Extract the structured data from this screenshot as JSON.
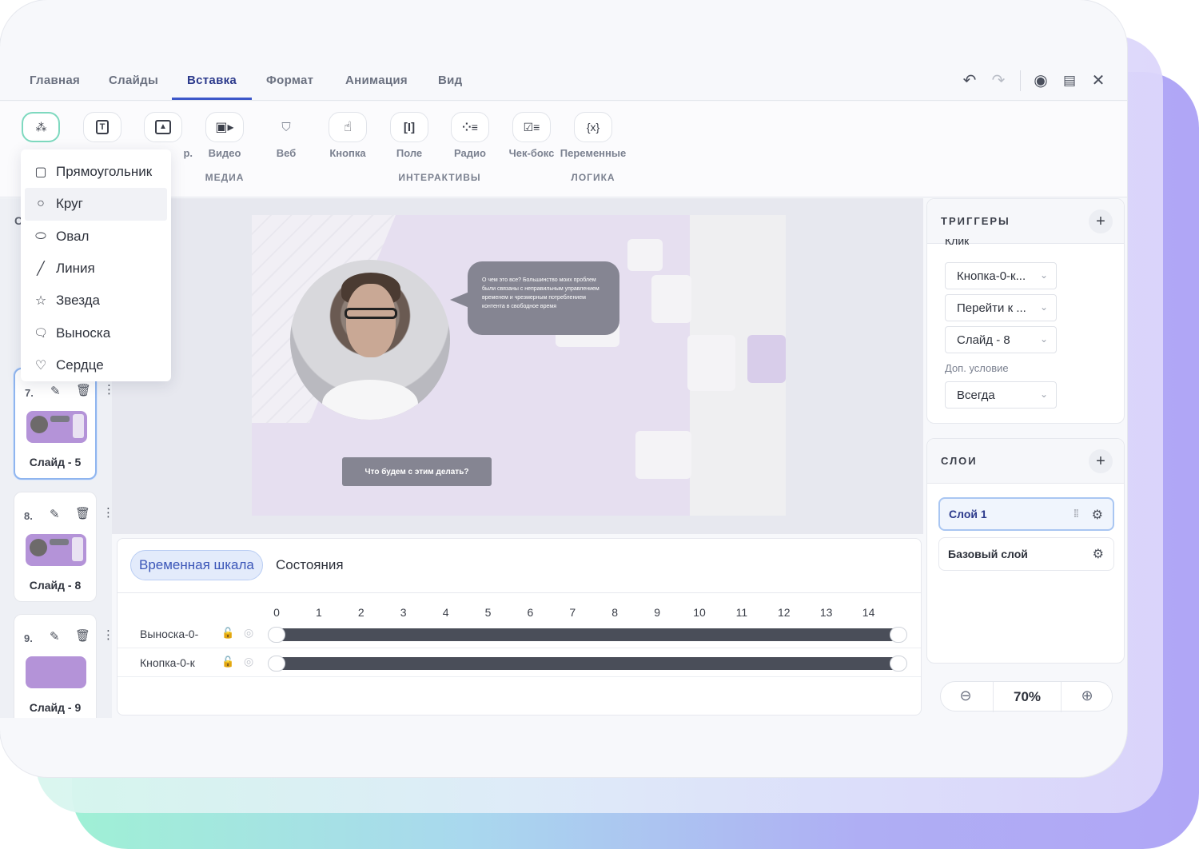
{
  "menu": {
    "tabs": [
      "Главная",
      "Слайды",
      "Вставка",
      "Формат",
      "Анимация",
      "Вид"
    ],
    "active_tab": "Вставка"
  },
  "ribbon": {
    "buttons": [
      {
        "label": "",
        "icon": "shapes-icon"
      },
      {
        "label": "",
        "icon": "text-box-icon"
      },
      {
        "label": "р.",
        "icon": "image-icon"
      },
      {
        "label": "Видео",
        "icon": "video-icon"
      },
      {
        "label": "Веб",
        "icon": "html5-icon"
      },
      {
        "label": "Кнопка",
        "icon": "pointer-hand-icon"
      },
      {
        "label": "Поле",
        "icon": "input-field-icon"
      },
      {
        "label": "Радио",
        "icon": "radio-list-icon"
      },
      {
        "label": "Чек-бокс",
        "icon": "checkbox-list-icon"
      },
      {
        "label": "Переменные",
        "icon": "variables-icon"
      }
    ],
    "groups": [
      "МЕДИА",
      "ИНТЕРАКТИВЫ",
      "ЛОГИКА"
    ]
  },
  "shape_menu": {
    "items": [
      {
        "label": "Прямоугольник",
        "icon": "rectangle-icon"
      },
      {
        "label": "Круг",
        "icon": "circle-icon"
      },
      {
        "label": "Овал",
        "icon": "oval-icon"
      },
      {
        "label": "Линия",
        "icon": "line-icon"
      },
      {
        "label": "Звезда",
        "icon": "star-icon"
      },
      {
        "label": "Выноска",
        "icon": "callout-icon"
      },
      {
        "label": "Сердце",
        "icon": "heart-icon"
      }
    ],
    "hovered": "Круг"
  },
  "slides": [
    {
      "num": "7.",
      "title": "Слайд - 5",
      "selected": true
    },
    {
      "num": "8.",
      "title": "Слайд - 8",
      "selected": false
    },
    {
      "num": "9.",
      "title": "Слайд - 9",
      "selected": false
    }
  ],
  "left_panel_partial": "С",
  "canvas": {
    "speech_text": "О чем это все? Большинство моих проблем были связаны с неправильным управлением временем и чрезмерным потреблением контента в свободное время",
    "button_text": "Что будем с этим делать?"
  },
  "timeline": {
    "tabs": [
      "Временная шкала",
      "Состояния"
    ],
    "active_tab": "Временная шкала",
    "ticks": [
      "0",
      "1",
      "2",
      "3",
      "4",
      "5",
      "6",
      "7",
      "8",
      "9",
      "10",
      "11",
      "12",
      "13",
      "14"
    ],
    "rows": [
      {
        "name": "Выноска-0-",
        "start": 0,
        "end": 14.7
      },
      {
        "name": "Кнопка-0-к",
        "start": 0,
        "end": 14.7
      }
    ]
  },
  "triggers": {
    "title": "ТРИГГЕРЫ",
    "partial_top": "Клик",
    "selects": [
      "Кнопка-0-к...",
      "Перейти к ...",
      "Слайд - 8"
    ],
    "extra_label": "Доп. условие",
    "extra_value": "Всегда"
  },
  "layers": {
    "title": "СЛОИ",
    "items": [
      {
        "label": "Слой 1",
        "active": true
      },
      {
        "label": "Базовый слой",
        "active": false
      }
    ]
  },
  "zoom": {
    "value": "70%"
  }
}
